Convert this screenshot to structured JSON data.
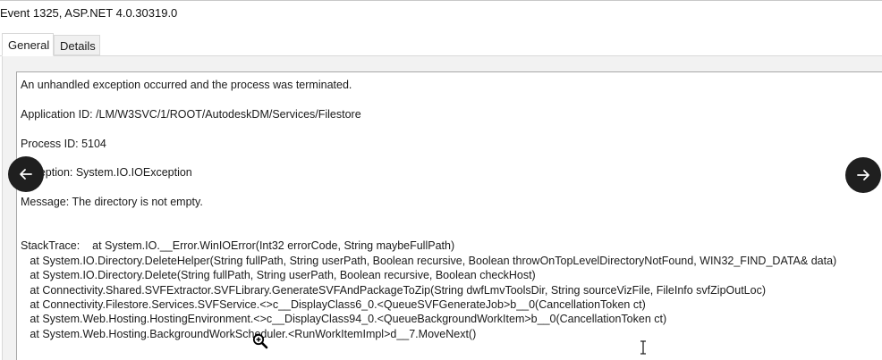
{
  "window": {
    "title": "Event 1325, ASP.NET 4.0.30319.0"
  },
  "tabs": [
    {
      "label": "General",
      "selected": true
    },
    {
      "label": "Details",
      "selected": false
    }
  ],
  "event_text": {
    "summary": "An unhandled exception occurred and the process was terminated.",
    "application_id": "Application ID: /LM/W3SVC/1/ROOT/AutodeskDM/Services/Filestore",
    "process_id": "Process ID: 5104",
    "exception": "Exception: System.IO.IOException",
    "message": "Message: The directory is not empty.",
    "stacktrace": [
      "StackTrace:    at System.IO.__Error.WinIOError(Int32 errorCode, String maybeFullPath)",
      "   at System.IO.Directory.DeleteHelper(String fullPath, String userPath, Boolean recursive, Boolean throwOnTopLevelDirectoryNotFound, WIN32_FIND_DATA& data)",
      "   at System.IO.Directory.Delete(String fullPath, String userPath, Boolean recursive, Boolean checkHost)",
      "   at Connectivity.Shared.SVFExtractor.SVFLibrary.GenerateSVFAndPackageToZip(String dwfLmvToolsDir, String sourceVizFile, FileInfo svfZipOutLoc)",
      "   at Connectivity.Filestore.Services.SVFService.<>c__DisplayClass6_0.<QueueSVFGenerateJob>b__0(CancellationToken ct)",
      "   at System.Web.Hosting.HostingEnvironment.<>c__DisplayClass94_0.<QueueBackgroundWorkItem>b__0(CancellationToken ct)",
      "   at System.Web.Hosting.BackgroundWorkScheduler.<RunWorkItemImpl>d__7.MoveNext()"
    ]
  },
  "icons": {
    "prev": "arrow-left-icon",
    "next": "arrow-right-icon",
    "zoom_cursor": "zoom-in-cursor-icon",
    "text_cursor": "i-beam-cursor-icon"
  },
  "colors": {
    "nav_button_bg": "#1f1f1f",
    "panel_bg": "#f2f2f2",
    "textbox_border": "#a8a8a8"
  }
}
